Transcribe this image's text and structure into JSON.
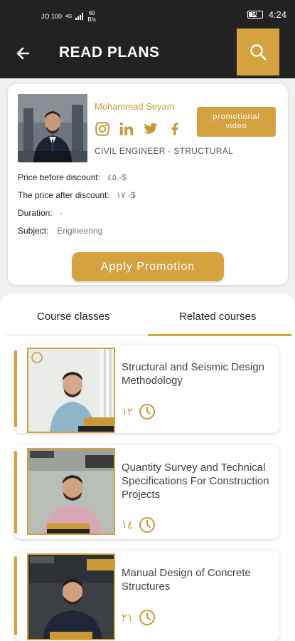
{
  "status": {
    "carrier": "JO 100",
    "signal": "4G",
    "speed_value": "69",
    "speed_unit": "B/s",
    "battery": "50",
    "time": "4:24"
  },
  "appbar": {
    "title": "READ PLANS"
  },
  "instructor": {
    "name": "Mohammad Seyam",
    "title": "CIVIL ENGINEER - STRUCTURAL",
    "promo_label": "promotional video",
    "socials": [
      "instagram-icon",
      "linkedin-icon",
      "twitter-icon",
      "facebook-icon"
    ]
  },
  "pricing": {
    "before_label": "Price before discount:",
    "before_value": "٤٥.-$",
    "after_label": "The price after discount:",
    "after_value": "١٧.-$",
    "duration_label": "Duration:",
    "duration_value": "-",
    "subject_label": "Subject:",
    "subject_value": "Engineering"
  },
  "apply_label": "Apply Promotion",
  "tabs": [
    {
      "label": "Course classes"
    },
    {
      "label": "Related courses"
    }
  ],
  "courses": [
    {
      "title": "Structural and Seismic Design Methodology",
      "count": "١٢"
    },
    {
      "title": "Quantity Survey and Technical Specifications For Construction Projects",
      "count": "١٤"
    },
    {
      "title": "Manual Design of Concrete Structures",
      "count": "٢١"
    }
  ],
  "colors": {
    "accent": "#d4a23f",
    "header": "#222222"
  }
}
